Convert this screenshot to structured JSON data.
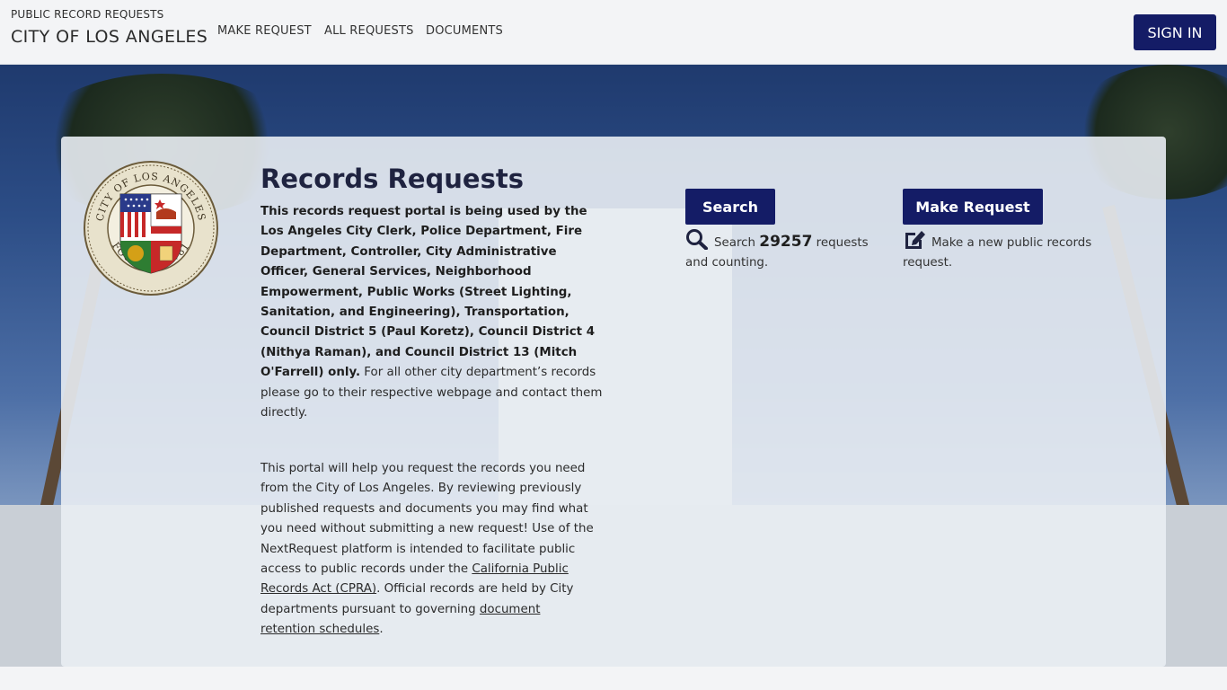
{
  "header": {
    "subtitle": "PUBLIC RECORD REQUESTS",
    "title": "CITY OF LOS ANGELES",
    "nav": [
      "MAKE REQUEST",
      "ALL REQUESTS",
      "DOCUMENTS"
    ],
    "sign_in": "SIGN IN"
  },
  "seal": {
    "top_text": "CITY OF LOS ANGELES",
    "bottom_text": "FOUNDED 1781"
  },
  "main": {
    "title": "Records Requests",
    "intro_bold": "This records request portal is being used by the Los Angeles City Clerk, Police Department, Fire Department, Controller, City Administrative Officer, General Services, Neighborhood Empowerment, Public Works (Street Lighting, Sanitation, and Engineering), Transportation, Council District 5 (Paul Koretz), Council District 4 (Nithya Raman), and Council District 13 (Mitch O'Farrell) only.",
    "intro_rest": " For all other city department’s records please go to their respective webpage and contact them directly.",
    "portal_text_1": "This portal will help you request the records you need from the City of Los Angeles. By reviewing previously published requests and documents you may find what you need without submitting a new request! Use of the NextRequest platform is intended to facilitate public access to public records under the ",
    "cpra_link": "California Public Records Act (CPRA)",
    "portal_text_2": ". Official records are held by City departments pursuant to governing ",
    "retention_link": "document retention schedules",
    "portal_text_3": "."
  },
  "search": {
    "button": "Search",
    "prefix": "Search ",
    "count": "29257",
    "suffix": " requests and counting.",
    "icon": "search-icon"
  },
  "make": {
    "button": "Make Request",
    "text": "Make a new public records request.",
    "icon": "edit-icon"
  },
  "colors": {
    "primary": "#141c66",
    "card": "#e9edf3",
    "header": "#f3f4f6"
  }
}
